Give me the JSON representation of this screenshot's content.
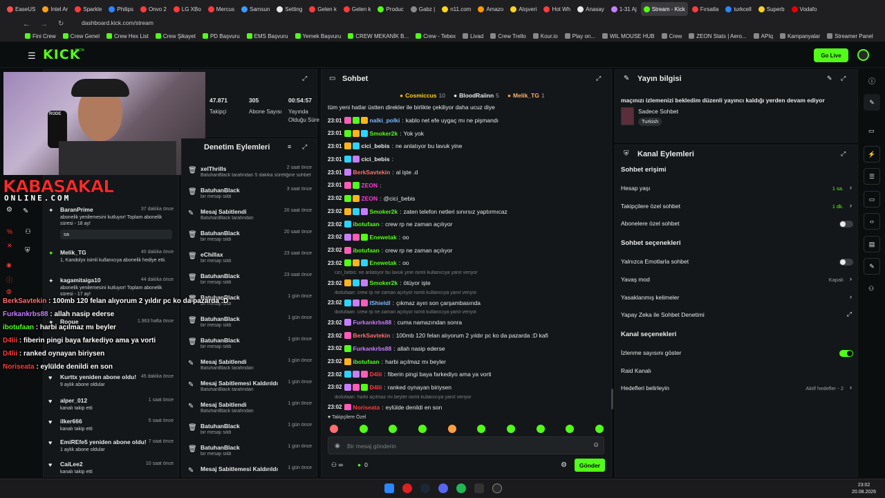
{
  "browser": {
    "tabs": [
      "EaseUS",
      "Intel Ar",
      "Sparkle",
      "Philips",
      "Onvo 2",
      "LG XBo",
      "Mercus",
      "Samsun",
      "Setting",
      "Gelen k",
      "Gelen k",
      "Produc",
      "Gabz |",
      "n11.com",
      "Amazo",
      "Alışveri",
      "Hot Wh",
      "Anasay",
      "1-31 Aj",
      "Stream - Kick",
      "Fırsatla",
      "turkcell",
      "Superb",
      "Vodafo"
    ],
    "active_tab": "Stream - Kick",
    "url": "dashboard.kick.com/stream",
    "bookmarks": [
      "Fini Crew",
      "Crew Genel",
      "Crew Hex List",
      "Crew Şikayet",
      "PD Başvuru",
      "EMS Başvuru",
      "Yemek Başvuru",
      "CREW MEKANİK B...",
      "Crew - Tebex",
      "Livad",
      "Crew Trello",
      "Kour.io",
      "Play on...",
      "WIL MOUSE HUB",
      "Crew",
      "ZEON Stats | Aero...",
      "APIq",
      "Kampanyalar",
      "Streamer Panel"
    ]
  },
  "nav": {
    "logo": "KICK",
    "beta": "BETA",
    "go_live": "Go Live"
  },
  "stats": [
    {
      "value": "47.871",
      "label": "Takipçi"
    },
    {
      "value": "305",
      "label": "Abone Sayısı"
    },
    {
      "value": "00:54:57",
      "label": "Yayında Olduğu Süre"
    }
  ],
  "overlay": {
    "logo_top": "KABASAKAL",
    "logo_bottom": "ONLINE.COM"
  },
  "activity": [
    {
      "name": "BaranPrime",
      "time": "37 dakika önce",
      "text": "abonelik yenilemesini kutluyor! Toplam abonelik süresi - 18 ay!",
      "extra": "sa"
    },
    {
      "name": "Melik_TG",
      "time": "40 dakika önce",
      "text": "1, Kandolyx isimli kullanıcıya abonelik hediye etti."
    },
    {
      "name": "kagamitaiga10",
      "time": "44 dakika önce",
      "text": "abonelik yenilemesini kutluyor! Toplam abonelik süresi - 17 ay!"
    },
    {
      "name": "Rooue",
      "time": "1.963 hafta önce",
      "text": ""
    },
    {
      "name": "Kurttx yeniden abone oldu!",
      "time": "45 dakika önce",
      "text": "9 aylık abone oldular"
    },
    {
      "name": "alper_012",
      "time": "1 saat önce",
      "text": "kanalı takip etti"
    },
    {
      "name": "ilker666",
      "time": "5 saat önce",
      "text": "kanalı takip etti"
    },
    {
      "name": "EmiREfe5 yeniden abone oldu!",
      "time": "7 saat önce",
      "text": "1 aylık abone oldular"
    },
    {
      "name": "CaiLee2",
      "time": "10 saat önce",
      "text": "kanalı takip etti"
    }
  ],
  "overlay_chat": [
    {
      "user": "BerkSavtekin",
      "color": "#ff6f6f",
      "text": "100mb 120 felan alıyorum 2 yıldır pc ko da pazarda :D"
    },
    {
      "user": "Furkankrbs88",
      "color": "#c77dff",
      "text": "allah nasip ederse"
    },
    {
      "user": "ibotufaan",
      "color": "#53fc18",
      "text": "harbi açılmaz mı beyler"
    },
    {
      "user": "D4lii",
      "color": "#ff3b3b",
      "text": "fiberin pingi baya farkediyo ama ya vorti"
    },
    {
      "user": "D4lii",
      "color": "#ff3b3b",
      "text": "ranked oynayan biriysen"
    },
    {
      "user": "Noriseata",
      "color": "#ff3b3b",
      "text": "eylülde denildi en son"
    }
  ],
  "moderation": {
    "title": "Denetim Eylemleri",
    "items": [
      {
        "name": "xelThrills",
        "time": "2 saat önce",
        "sub": "BatuhanBlack tarafından 5 dakika süreliğine sohbetten uzaklaştırıldı"
      },
      {
        "name": "BatuhanBlack",
        "time": "3 saat önce",
        "sub": "bir mesajı sildi"
      },
      {
        "name": "Mesaj Sabitlendi",
        "time": "20 saat önce",
        "sub": "BatuhanBlack tarafından"
      },
      {
        "name": "BatuhanBlack",
        "time": "20 saat önce",
        "sub": "bir mesajı sildi"
      },
      {
        "name": "eChillax",
        "time": "23 saat önce",
        "sub": "bir mesajı sildi"
      },
      {
        "name": "BatuhanBlack",
        "time": "23 saat önce",
        "sub": "bir mesajı sildi"
      },
      {
        "name": "BatuhanBlack",
        "time": "1 gün önce",
        "sub": "bir mesajı sildi"
      },
      {
        "name": "BatuhanBlack",
        "time": "1 gün önce",
        "sub": "bir mesajı sildi"
      },
      {
        "name": "BatuhanBlack",
        "time": "1 gün önce",
        "sub": "bir mesajı sildi"
      },
      {
        "name": "Mesaj Sabitlendi",
        "time": "1 gün önce",
        "sub": "BatuhanBlack tarafından"
      },
      {
        "name": "Mesaj Sabitlemesi Kaldırıldı",
        "time": "1 gün önce",
        "sub": "BatuhanBlack tarafından"
      },
      {
        "name": "Mesaj Sabitlendi",
        "time": "1 gün önce",
        "sub": "BatuhanBlack tarafından"
      },
      {
        "name": "BatuhanBlack",
        "time": "1 gün önce",
        "sub": "bir mesajı sildi"
      },
      {
        "name": "BatuhanBlack",
        "time": "1 gün önce",
        "sub": "bir mesajı sildi"
      },
      {
        "name": "Mesaj Sabitlemesi Kaldırıldı",
        "time": "1 gün önce",
        "sub": ""
      }
    ]
  },
  "chat": {
    "title": "Sohbet",
    "top_gifters": [
      {
        "name": "Cosmiccus",
        "count": "10"
      },
      {
        "name": "BloodRaiinn",
        "count": "5"
      },
      {
        "name": "Melik_TG",
        "count": "1"
      }
    ],
    "pinned": "tüm yeni hatlar üstten direkler ile birlikte çekiliyor daha ucuz diye",
    "messages": [
      {
        "time": "23:01",
        "user": "nalki_polki",
        "color": "#7ab8ff",
        "text": "kablo net efe uygaç mı ne pişmandı",
        "reply": ""
      },
      {
        "time": "23:01",
        "user": "Smoker2k",
        "color": "#53fc18",
        "text": "Yok yok",
        "reply": ""
      },
      {
        "time": "23:01",
        "user": "cici_bebis",
        "color": "#e8eaeb",
        "text": "ne anlatıyor bu lavuk yine",
        "reply": ""
      },
      {
        "time": "23:01",
        "user": "cici_bebis",
        "color": "#e8eaeb",
        "text": "",
        "reply": ""
      },
      {
        "time": "23:01",
        "user": "BerkSavtekin",
        "color": "#ff6f6f",
        "text": "al işte .d",
        "reply": ""
      },
      {
        "time": "23:01",
        "user": "ZEON",
        "color": "#ff3bd8",
        "text": "",
        "reply": ""
      },
      {
        "time": "23:02",
        "user": "ZEON",
        "color": "#ff3bd8",
        "text": "@cici_bebis",
        "reply": ""
      },
      {
        "time": "23:02",
        "user": "Smoker2k",
        "color": "#53fc18",
        "text": "zaten telefon netleri sınırsız yaptırmıcaz",
        "reply": ""
      },
      {
        "time": "23:02",
        "user": "ibotufaan",
        "color": "#53fc18",
        "text": "crew rp ne zaman açılıyor",
        "reply": ""
      },
      {
        "time": "23:02",
        "user": "Enewetak",
        "color": "#53fc18",
        "text": "oo",
        "reply": ""
      },
      {
        "time": "23:02",
        "user": "ibotufaan",
        "color": "#53fc18",
        "text": "crew rp ne zaman açılıyor",
        "reply": ""
      },
      {
        "time": "23:02",
        "user": "Enewetak",
        "color": "#53fc18",
        "text": "oo",
        "reply": ""
      },
      {
        "time": "23:02",
        "user": "Smoker2k",
        "color": "#53fc18",
        "text": "ötüyor işte",
        "reply": "cici_bebis: ne anlatıyor bu lavuk yine isimli kullanıcıya yanıt veriyor"
      },
      {
        "time": "23:02",
        "user": "lShieldl",
        "color": "#7ab8ff",
        "text": "çıkmaz ayın son çarşambasında",
        "reply": "ibotufaan: crew rp ne zaman açılıyor isimli kullanıcıya yanıt veriyor"
      },
      {
        "time": "23:02",
        "user": "Furkankrbs88",
        "color": "#c77dff",
        "text": "cuma namazından sonra",
        "reply": "ibotufaan: crew rp ne zaman açılıyor isimli kullanıcıya yanıt veriyor"
      },
      {
        "time": "23:02",
        "user": "BerkSavtekin",
        "color": "#ff6f6f",
        "text": "100mb 120 felan alıyorum 2 yıldır pc ko da pazarda :D kafi",
        "reply": ""
      },
      {
        "time": "23:02",
        "user": "Furkankrbs88",
        "color": "#c77dff",
        "text": "allah nasip ederse",
        "reply": ""
      },
      {
        "time": "23:02",
        "user": "ibotufaan",
        "color": "#53fc18",
        "text": "harbi açılmaz mı beyler",
        "reply": ""
      },
      {
        "time": "23:02",
        "user": "D4lii",
        "color": "#ff3b3b",
        "text": "fiberin pingi baya farkediyo ama ya vorti",
        "reply": ""
      },
      {
        "time": "23:02",
        "user": "D4lii",
        "color": "#ff3b3b",
        "text": "ranked oynayan biriysen",
        "reply": ""
      },
      {
        "time": "23:02",
        "user": "Noriseata",
        "color": "#ff3b3b",
        "text": "eylülde denildi en son",
        "reply": "ibotufaan: harbi açılmaz mı beyler isimli kullanıcıya yanıt veriyor"
      }
    ],
    "followers_only": "Takipçilere Özel",
    "input_placeholder": "Bir mesaj gönderin",
    "points": "0",
    "send": "Gönder"
  },
  "stream_info": {
    "title": "Yayın bilgisi",
    "desc": "maçınızı izlemenizi bekledim düzenli yayıncı kaldığı yerden devam ediyor",
    "category": "Sadece Sohbet",
    "language": "Turkish"
  },
  "channel_actions": {
    "title": "Kanal Eylemleri",
    "sections": [
      {
        "heading": "Sohbet erişimi",
        "rows": [
          {
            "label": "Hesap yaşı",
            "value": "1 sa.",
            "control": "chevron"
          },
          {
            "label": "Takipçilere özel sohbet",
            "value": "1 dk.",
            "control": "chevron"
          },
          {
            "label": "Abonelere özel sohbet",
            "value": "",
            "control": "toggle-off"
          }
        ]
      },
      {
        "heading": "Sohbet seçenekleri",
        "rows": [
          {
            "label": "Yalnızca Emotlarla sohbet",
            "value": "",
            "control": "toggle-off"
          },
          {
            "label": "Yavaş mod",
            "value": "Kapalı",
            "control": "chevron"
          },
          {
            "label": "Yasaklanmış kelimeler",
            "value": "",
            "control": "chevron"
          },
          {
            "label": "Yapay Zeka ile Sohbet Denetimi",
            "value": "",
            "control": "external"
          }
        ]
      },
      {
        "heading": "Kanal seçenekleri",
        "rows": [
          {
            "label": "İzlenme sayısını göster",
            "value": "",
            "control": "toggle-on"
          },
          {
            "label": "Raid Kanalı",
            "value": "",
            "control": "none"
          },
          {
            "label": "Hedefleri belirleyin",
            "value": "Aktif hedefler - 2",
            "control": "chevron"
          }
        ]
      }
    ]
  },
  "taskbar": {
    "time": "23:02",
    "date": "20.08.2026"
  },
  "colors": {
    "accent": "#53fc18",
    "bg": "#0b0e0f",
    "panel": "#141719"
  }
}
